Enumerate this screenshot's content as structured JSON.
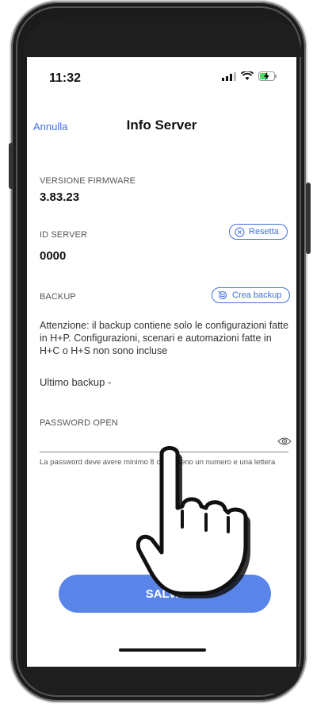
{
  "status": {
    "time": "11:32"
  },
  "nav": {
    "cancel": "Annulla",
    "title": "Info Server"
  },
  "firmware": {
    "label": "VERSIONE FIRMWARE",
    "value": "3.83.23"
  },
  "server_id": {
    "label": "ID SERVER",
    "value": "0000",
    "reset_label": "Resetta"
  },
  "backup": {
    "label": "BACKUP",
    "create_label": "Crea backup",
    "notice": "Attenzione: il backup contiene solo le configurazioni fatte in H+P. Configurazioni, scenari e automazioni fatte in H+C o H+S non sono incluse",
    "last": "Ultimo backup -"
  },
  "password": {
    "label": "PASSWORD OPEN",
    "value": "",
    "hint": "La password deve avere minimo 8 c... almeno un numero e una lettera"
  },
  "actions": {
    "save": "SALVA"
  },
  "colors": {
    "accent": "#3f6fe0",
    "save_button": "#5a85e8"
  }
}
